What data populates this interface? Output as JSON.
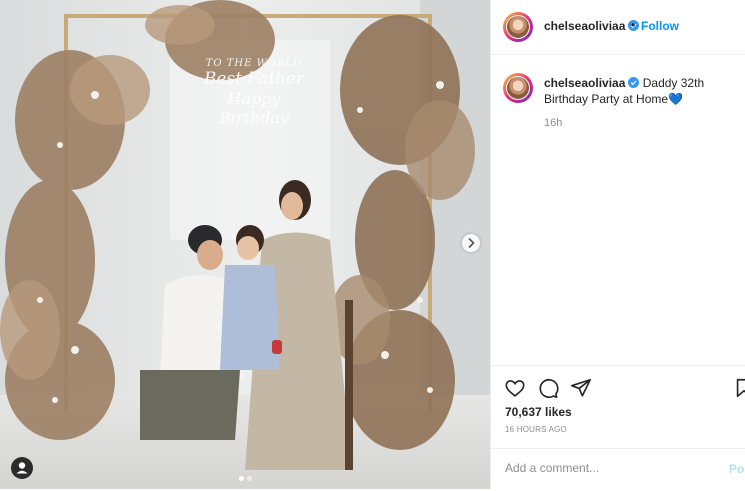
{
  "post": {
    "username": "chelseaoliviaa",
    "follow_label": "Follow",
    "caption": "Daddy 32th Birthday Party at Home",
    "caption_emoji": "💙",
    "caption_age": "16h",
    "likes": "70,637 likes",
    "posted_ago": "16 HOURS AGO",
    "comment_placeholder": "Add a comment...",
    "post_label": "Po",
    "carousel_count": 2,
    "carousel_active": 0
  },
  "photo": {
    "sign_line1": "TO THE WORLD",
    "sign_line2": "Best Father",
    "sign_line3": "Happy Birthday"
  },
  "colors": {
    "verified": "#3897f0",
    "follow": "#0095f6",
    "heart": "#1e6fd9"
  },
  "icons": [
    "verified-icon",
    "like-icon",
    "comment-icon",
    "share-icon",
    "save-icon",
    "next-arrow-icon",
    "user-tag-icon"
  ]
}
